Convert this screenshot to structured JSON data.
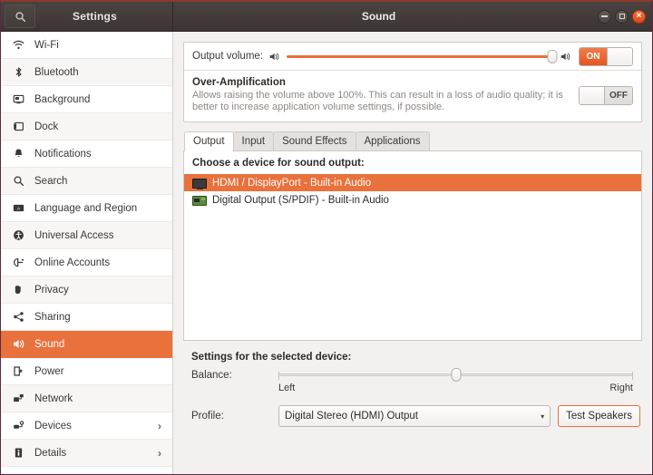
{
  "window": {
    "sidebar_title": "Settings",
    "main_title": "Sound",
    "search_icon": "search-icon",
    "minimize_label": "",
    "maximize_label": "",
    "close_label": "×"
  },
  "sidebar": {
    "items": [
      {
        "label": "Wi-Fi",
        "icon": "wifi-icon",
        "selected": false,
        "chevron": ""
      },
      {
        "label": "Bluetooth",
        "icon": "bluetooth-icon",
        "selected": false,
        "chevron": ""
      },
      {
        "label": "Background",
        "icon": "background-icon",
        "selected": false,
        "chevron": ""
      },
      {
        "label": "Dock",
        "icon": "dock-icon",
        "selected": false,
        "chevron": ""
      },
      {
        "label": "Notifications",
        "icon": "bell-icon",
        "selected": false,
        "chevron": ""
      },
      {
        "label": "Search",
        "icon": "search-icon",
        "selected": false,
        "chevron": ""
      },
      {
        "label": "Language and Region",
        "icon": "language-icon",
        "selected": false,
        "chevron": ""
      },
      {
        "label": "Universal Access",
        "icon": "accessibility-icon",
        "selected": false,
        "chevron": ""
      },
      {
        "label": "Online Accounts",
        "icon": "online-accounts-icon",
        "selected": false,
        "chevron": ""
      },
      {
        "label": "Privacy",
        "icon": "privacy-hand-icon",
        "selected": false,
        "chevron": ""
      },
      {
        "label": "Sharing",
        "icon": "sharing-icon",
        "selected": false,
        "chevron": ""
      },
      {
        "label": "Sound",
        "icon": "sound-icon",
        "selected": true,
        "chevron": ""
      },
      {
        "label": "Power",
        "icon": "power-icon",
        "selected": false,
        "chevron": ""
      },
      {
        "label": "Network",
        "icon": "network-icon",
        "selected": false,
        "chevron": ""
      },
      {
        "label": "Devices",
        "icon": "devices-icon",
        "selected": false,
        "chevron": "›"
      },
      {
        "label": "Details",
        "icon": "details-icon",
        "selected": false,
        "chevron": "›"
      }
    ]
  },
  "volume": {
    "label": "Output volume:",
    "speaker_icon": "speaker-icon",
    "value_percent": 100,
    "toggle_label": "ON",
    "toggle_state": "on"
  },
  "over_amplification": {
    "title": "Over-Amplification",
    "description": "Allows raising the volume above 100%. This can result in a loss of audio quality; it is better to increase application volume settings, if possible.",
    "toggle_label": "OFF",
    "toggle_state": "off"
  },
  "tabs": [
    {
      "label": "Output",
      "active": true
    },
    {
      "label": "Input",
      "active": false
    },
    {
      "label": "Sound Effects",
      "active": false
    },
    {
      "label": "Applications",
      "active": false
    }
  ],
  "device_list": {
    "heading": "Choose a device for sound output:",
    "rows": [
      {
        "label": "HDMI / DisplayPort - Built-in Audio",
        "icon": "monitor-icon",
        "selected": true
      },
      {
        "label": "Digital Output (S/PDIF) - Built-in Audio",
        "icon": "sound-card-icon",
        "selected": false
      }
    ]
  },
  "device_settings": {
    "heading": "Settings for the selected device:",
    "balance_label": "Balance:",
    "balance_left": "Left",
    "balance_right": "Right",
    "balance_value_percent": 50,
    "profile_label": "Profile:",
    "profile_value": "Digital Stereo (HDMI) Output",
    "profile_arrow": "▾",
    "test_button_label": "Test Speakers"
  },
  "colors": {
    "accent_orange": "#e8713c",
    "titlebar_dark": "#3b3533",
    "panel_bg": "#f2f1f0"
  }
}
